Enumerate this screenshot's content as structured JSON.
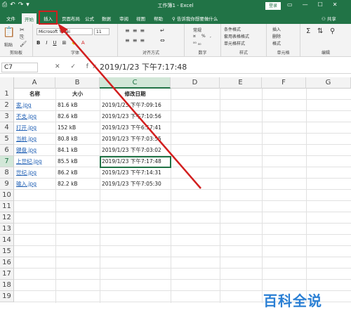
{
  "titlebar": {
    "title": "工作簿1 - Excel",
    "login_label": "登录",
    "quick_access": [
      "⎙",
      "↶",
      "↷",
      "▾"
    ],
    "window_buttons": [
      "▭",
      "—",
      "☐",
      "✕"
    ]
  },
  "tabs": [
    "文件",
    "开始",
    "插入",
    "页面布局",
    "公式",
    "数据",
    "审阅",
    "视图",
    "帮助"
  ],
  "tell_me": "告诉我你想要做什么",
  "share": "共享",
  "ribbon": {
    "clipboard": {
      "paste": "粘贴",
      "label": "剪贴板"
    },
    "font": {
      "name": "Microsoft Yahei",
      "size": "11",
      "label": "字体",
      "bold": "B",
      "italic": "I",
      "underline": "U"
    },
    "alignment": {
      "label": "对齐方式"
    },
    "number": {
      "format": "常规",
      "label": "数字",
      "percent": "%",
      "comma": ","
    },
    "styles": {
      "items": [
        "条件格式",
        "套用表格格式",
        "单元格样式"
      ],
      "label": "样式"
    },
    "cells": {
      "items": [
        "插入",
        "删除",
        "格式"
      ],
      "label": "单元格"
    },
    "editing": {
      "label": "编辑"
    }
  },
  "formula_bar": {
    "name_box": "C7",
    "fx": "✕ ✓ fx",
    "content": "2019/1/23  下午7:17:48"
  },
  "columns": [
    "A",
    "B",
    "C",
    "D",
    "E",
    "F",
    "G"
  ],
  "rows": [
    "1",
    "2",
    "3",
    "4",
    "5",
    "6",
    "7",
    "8",
    "9",
    "10",
    "11",
    "12",
    "13",
    "14",
    "15",
    "16",
    "17",
    "18",
    "19"
  ],
  "sheet": {
    "headers": {
      "name": "名称",
      "size": "大小",
      "date": "修改日期"
    },
    "data": [
      {
        "name": "家.jpg",
        "size": "81.6 kB",
        "date": "2019/1/23 下午7:09:16"
      },
      {
        "name": "不支.jpg",
        "size": "82.6 kB",
        "date": "2019/1/23 下午7:10:56"
      },
      {
        "name": "打开.jpg",
        "size": "152 kB",
        "date": "2019/1/23 下午6:57:41"
      },
      {
        "name": "当前.jpg",
        "size": "80.8 kB",
        "date": "2019/1/23 下午7:03:55"
      },
      {
        "name": "键盘.jpg",
        "size": "84.1 kB",
        "date": "2019/1/23 下午7:03:02"
      },
      {
        "name": "上世纪.jpg",
        "size": "85.5 kB",
        "date": "2019/1/23 下午7:17:48"
      },
      {
        "name": "世纪.jpg",
        "size": "86.2 kB",
        "date": "2019/1/23 下午7:14:31"
      },
      {
        "name": "输入.jpg",
        "size": "82.2 kB",
        "date": "2019/1/23 下午7:05:30"
      }
    ]
  },
  "watermark": "百科全说",
  "colors": {
    "accent": "#217346",
    "annotation_red": "#d21f1f",
    "link": "#1f5fb4"
  }
}
